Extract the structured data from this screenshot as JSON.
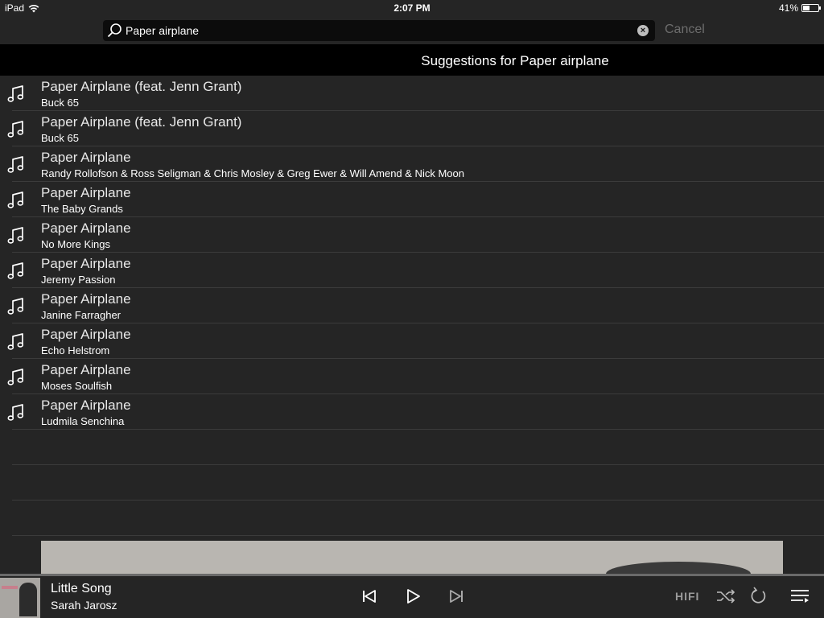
{
  "status_bar": {
    "device": "iPad",
    "time": "2:07 PM",
    "battery": "41%"
  },
  "search": {
    "query": "Paper airplane",
    "cancel_label": "Cancel"
  },
  "suggestions_header": "Suggestions for Paper airplane",
  "results": [
    {
      "title": "Paper Airplane (feat. Jenn Grant)",
      "artist": "Buck 65"
    },
    {
      "title": "Paper Airplane (feat. Jenn Grant)",
      "artist": "Buck 65"
    },
    {
      "title": "Paper Airplane",
      "artist": "Randy Rollofson & Ross Seligman & Chris Mosley & Greg Ewer & Will Amend & Nick Moon"
    },
    {
      "title": "Paper Airplane",
      "artist": "The Baby Grands"
    },
    {
      "title": "Paper Airplane",
      "artist": "No More Kings"
    },
    {
      "title": "Paper Airplane",
      "artist": "Jeremy Passion"
    },
    {
      "title": "Paper Airplane",
      "artist": "Janine Farragher"
    },
    {
      "title": "Paper Airplane",
      "artist": "Echo Helstrom"
    },
    {
      "title": "Paper Airplane",
      "artist": "Moses Soulfish"
    },
    {
      "title": "Paper Airplane",
      "artist": "Ludmila Senchina"
    }
  ],
  "now_playing": {
    "title": "Little Song",
    "artist": "Sarah Jarosz",
    "quality_label": "HIFI"
  },
  "icons": {
    "result": "music-note-icon",
    "controls": [
      "previous-icon",
      "play-icon",
      "next-icon",
      "shuffle-icon",
      "repeat-icon",
      "queue-icon"
    ]
  }
}
